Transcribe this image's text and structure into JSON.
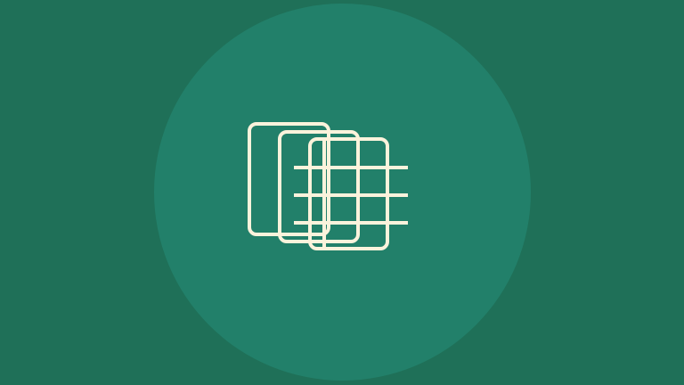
{
  "icon": {
    "name": "stacked-sheets-grid-icon"
  },
  "colors": {
    "background": "#1f7058",
    "circle": "#22806a",
    "stroke": "#fbf3dc"
  }
}
